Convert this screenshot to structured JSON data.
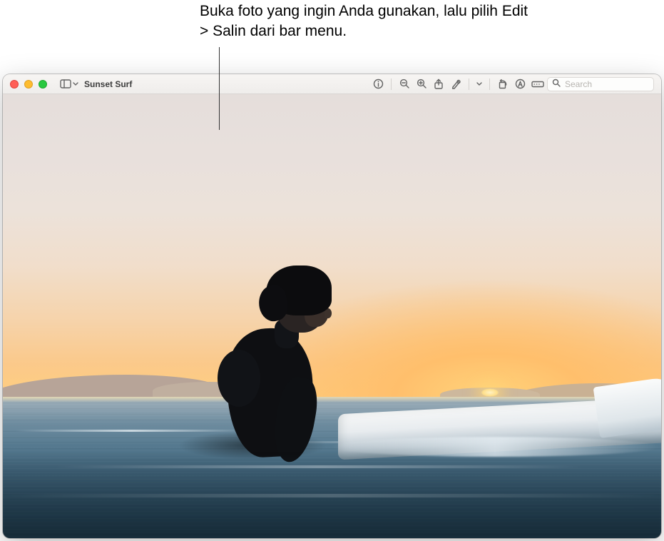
{
  "callout": {
    "text": "Buka foto yang ingin Anda gunakan, lalu pilih Edit > Salin dari bar menu."
  },
  "window": {
    "title": "Sunset Surf"
  },
  "toolbar": {
    "icons": {
      "sidebar": "sidebar-icon",
      "sidebar_chevron": "chevron-down-icon",
      "info": "info-icon",
      "zoom_out": "zoom-out-icon",
      "zoom_in": "zoom-in-icon",
      "share": "share-icon",
      "markup": "markup-pencil-icon",
      "markup_chevron": "chevron-down-icon",
      "rotate": "rotate-left-icon",
      "annotate": "annotate-circle-a-icon",
      "form": "form-field-icon"
    }
  },
  "search": {
    "placeholder": "Search",
    "value": ""
  }
}
